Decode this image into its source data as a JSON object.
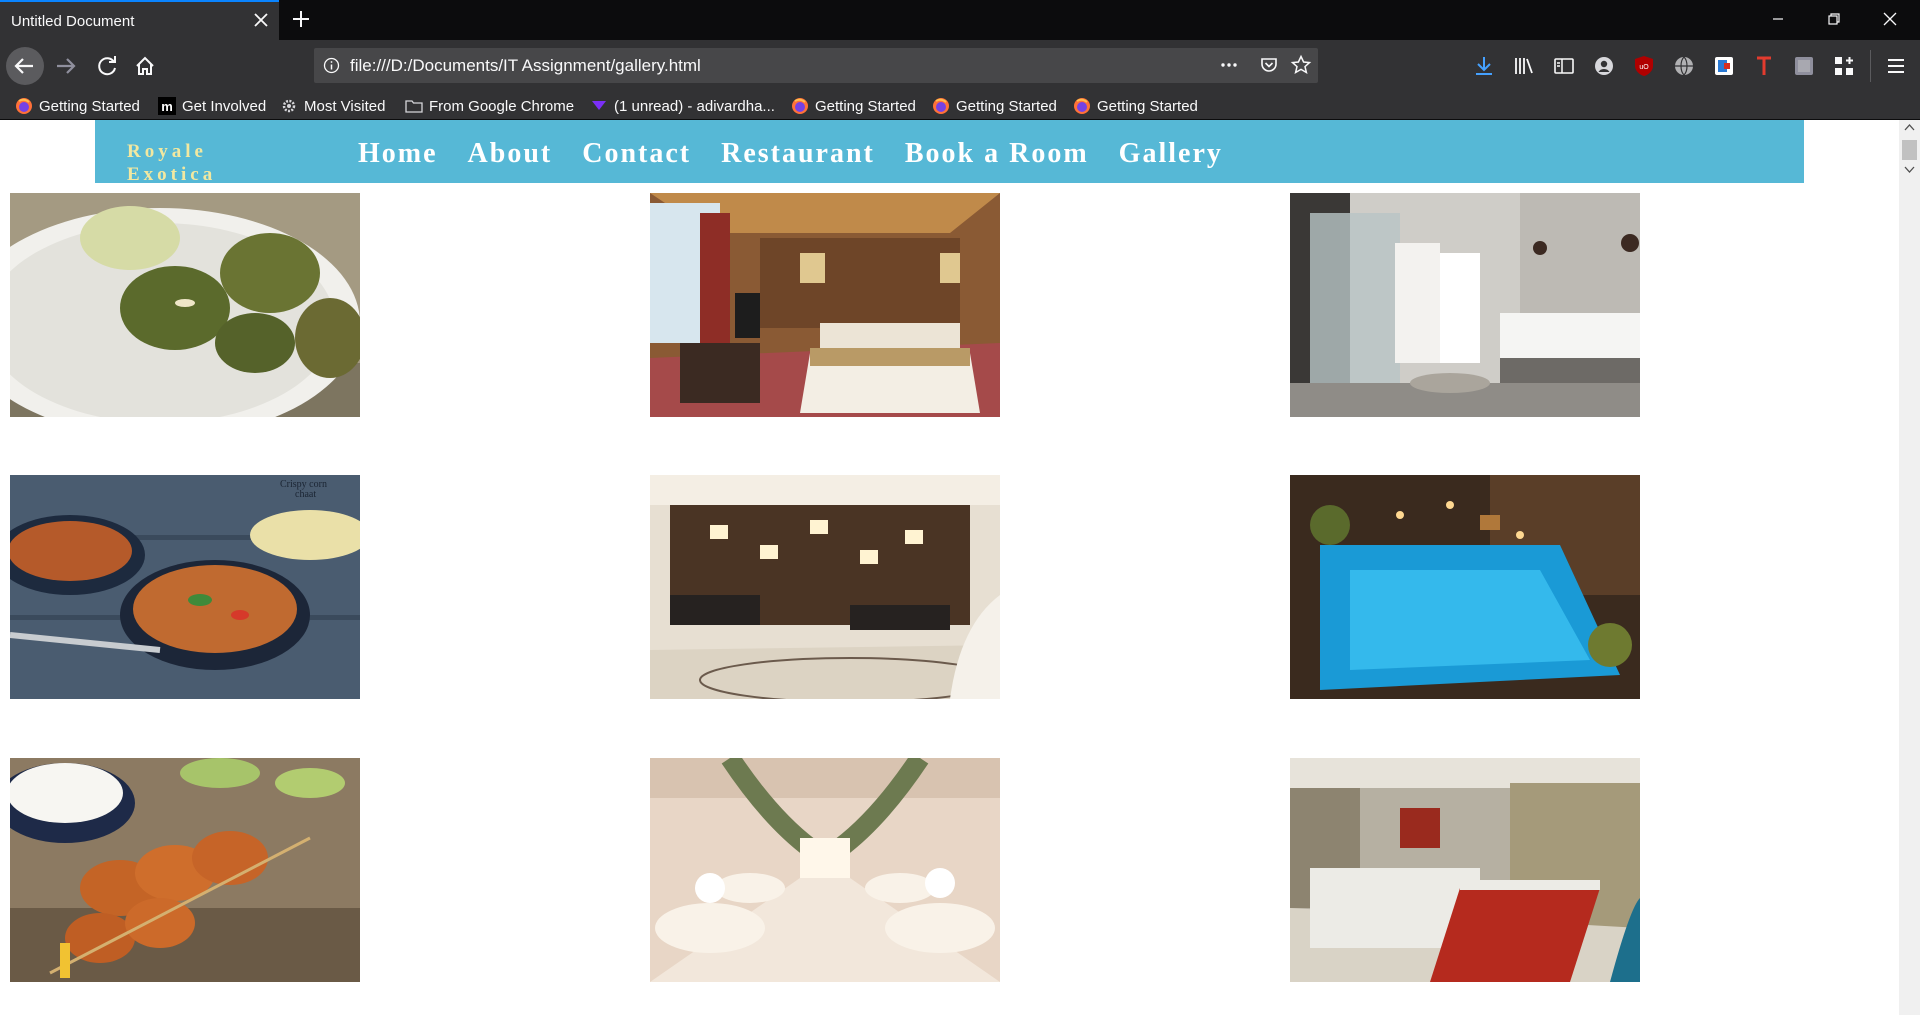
{
  "browser": {
    "tab": {
      "title": "Untitled Document"
    },
    "url": "file:///D:/Documents/IT Assignment/gallery.html",
    "accent_color": "#0a84ff",
    "bookmarks": [
      {
        "label": "Getting Started",
        "icon": "firefox-icon"
      },
      {
        "label": "Get Involved",
        "icon": "mozilla-icon"
      },
      {
        "label": "Most Visited",
        "icon": "gear-icon"
      },
      {
        "label": "From Google Chrome",
        "icon": "folder-icon"
      },
      {
        "label": "(1 unread) - adivardha...",
        "icon": "yahoo-mail-icon"
      },
      {
        "label": "Getting Started",
        "icon": "firefox-icon"
      },
      {
        "label": "Getting Started",
        "icon": "firefox-icon"
      },
      {
        "label": "Getting Started",
        "icon": "firefox-icon"
      }
    ],
    "toolbar_icons": [
      "download-icon",
      "library-icon",
      "sidebar-icon",
      "account-icon",
      "ublock-icon",
      "globe-icon",
      "extension-icon",
      "t-extension-icon",
      "screenshot-icon",
      "grid-icon",
      "menu-icon"
    ]
  },
  "site": {
    "logo_line1": "Royale",
    "logo_line2": "Exotica",
    "nav_color": "#56b8d6",
    "menu": [
      "Home",
      "About",
      "Contact",
      "Restaurant",
      "Book a Room",
      "Gallery"
    ]
  },
  "gallery": [
    {
      "subject": "hara-bhara-kebab-plate"
    },
    {
      "subject": "hotel-bedroom"
    },
    {
      "subject": "hotel-bathroom"
    },
    {
      "subject": "crispy-corn-chaat"
    },
    {
      "subject": "hotel-reception-lobby"
    },
    {
      "subject": "swimming-pool-night"
    },
    {
      "subject": "prawn-skewers-rice"
    },
    {
      "subject": "banquet-hall"
    },
    {
      "subject": "conference-room"
    }
  ]
}
